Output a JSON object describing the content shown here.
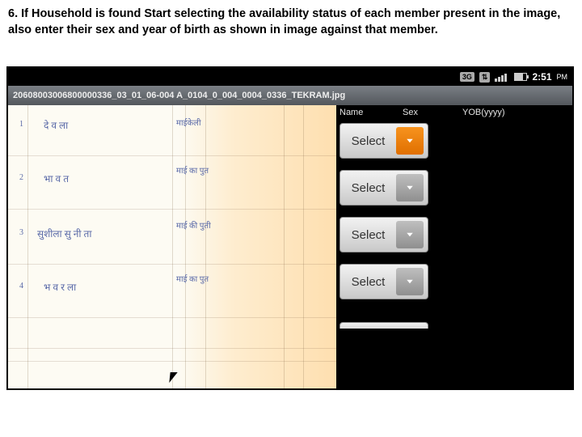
{
  "instruction_text": "6. If Household is found Start selecting the availability status of each member present in the image, also enter their sex and year of birth as shown in image against that member.",
  "statusbar": {
    "net_badge": "3G",
    "icon_badge": "⇅",
    "time": "2:51",
    "ampm": "PM"
  },
  "titlebar": {
    "filename": "20608003006800000336_03_01_06-004 A_0104_0_004_0004_0336_TEKRAM.jpg"
  },
  "panel": {
    "headers": {
      "c1": "Name",
      "c2": "Sex",
      "c3": "YOB(yyyy)"
    },
    "select_label": "Select",
    "rows": [
      {
        "active": true
      },
      {
        "active": false
      },
      {
        "active": false
      },
      {
        "active": false
      }
    ]
  },
  "handwriting": {
    "r1a": "दे व ला",
    "r1b": "माईकेली",
    "n1": "1",
    "r2a": "भा व त",
    "r2b": "माई का\nपुत",
    "n2": "2",
    "r3a": "सुशीला   सु  नी  ता",
    "r3b": "माई की\nपुती",
    "n3": "3",
    "r4a": "भ व  र ला",
    "r4b": "माई का\nपुत",
    "n4": "4"
  }
}
